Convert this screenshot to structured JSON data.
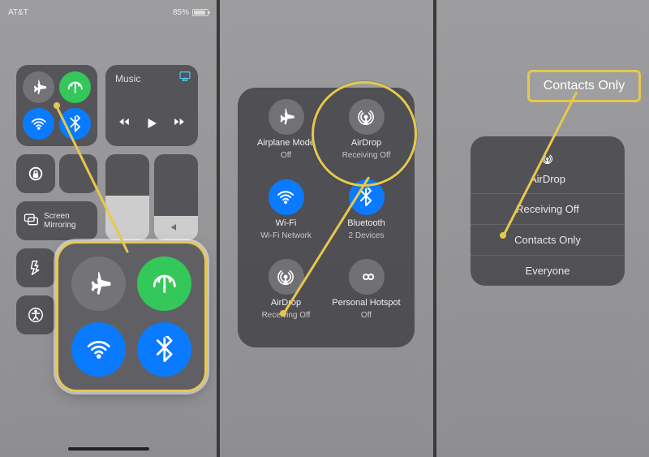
{
  "status": {
    "carrier": "AT&T",
    "battery_pct": "85%"
  },
  "panel1": {
    "music_label": "Music",
    "mirror_label": "Screen Mirroring"
  },
  "panel2": {
    "cells": [
      {
        "title": "Airplane Mode",
        "sub": "Off"
      },
      {
        "title": "AirDrop",
        "sub": "Receiving Off"
      },
      {
        "title": "Wi-Fi",
        "sub": "Wi-Fi Network"
      },
      {
        "title": "Bluetooth",
        "sub": "2 Devices"
      },
      {
        "title": "AirDrop",
        "sub": "Receiving Off"
      },
      {
        "title": "Personal Hotspot",
        "sub": "Off"
      }
    ]
  },
  "panel3": {
    "pill": "Contacts Only",
    "menu_title": "AirDrop",
    "items": [
      "Receiving Off",
      "Contacts Only",
      "Everyone"
    ]
  }
}
